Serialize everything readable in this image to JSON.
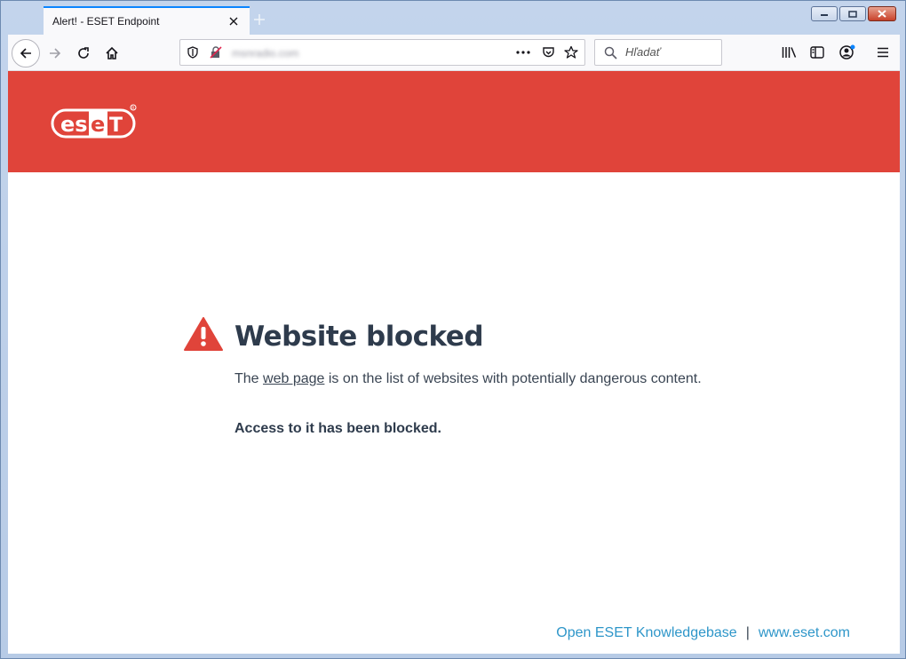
{
  "browser": {
    "tab_title": "Alert! - ESET Endpoint",
    "url": "msnradio.com",
    "search_placeholder": "Hľadať"
  },
  "page": {
    "logo_text": "eset",
    "heading": "Website blocked",
    "desc_prefix": "The ",
    "desc_link": "web page",
    "desc_suffix": " is on the list of websites with potentially dangerous content.",
    "blocked_text": "Access to it has been blocked.",
    "footer_kb": "Open ESET Knowledgebase",
    "footer_sep": "|",
    "footer_site": "www.eset.com"
  },
  "colors": {
    "brand_red": "#e0443a",
    "heading": "#2e3b4c",
    "link_blue": "#2e96c9",
    "tab_accent": "#0a84ff"
  }
}
